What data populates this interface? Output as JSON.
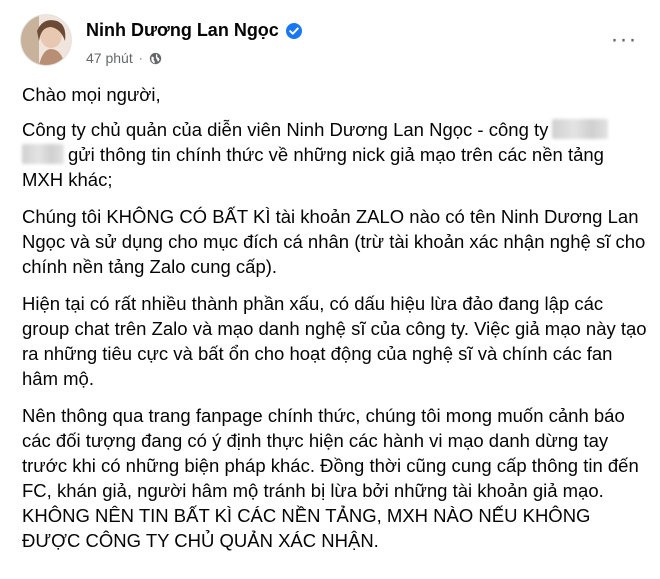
{
  "header": {
    "author_name": "Ninh Dương Lan Ngọc",
    "timestamp": "47 phút",
    "separator": "·",
    "verified_icon": "verified-badge-icon",
    "audience_icon": "globe-icon",
    "more_label": "···"
  },
  "post": {
    "greeting": "Chào mọi người,",
    "p1_start": "Công ty chủ quản của diễn viên Ninh Dương Lan Ngọc - công ty",
    "p1_end": "gửi thông tin chính thức về những nick giả mạo trên các nền tảng MXH khác;",
    "p2": "Chúng tôi KHÔNG CÓ BẤT KÌ tài khoản ZALO nào có tên Ninh Dương Lan Ngọc và sử dụng cho mục đích cá nhân (trừ tài khoản xác nhận nghệ sĩ cho chính nền tảng Zalo cung cấp).",
    "p3": "Hiện tại có rất nhiều thành phần xấu, có dấu hiệu lừa đảo đang lập các group chat trên Zalo và mạo danh nghệ sĩ của công ty. Việc giả mạo này tạo ra những tiêu cực và bất ổn cho hoạt động của nghệ sĩ và chính các fan hâm mộ.",
    "p4": "Nên thông qua trang fanpage chính thức, chúng tôi mong muốn cảnh báo các đối tượng đang có ý định thực hiện các hành vi mạo danh dừng tay trước khi có những biện pháp khác. Đồng thời cũng cung cấp thông tin đến FC, khán giả, người hâm mộ tránh bị lừa bởi những tài khoản giả mạo. KHÔNG NÊN TIN BẤT KÌ CÁC NỀN TẢNG, MXH NÀO NẾU KHÔNG ĐƯỢC CÔNG TY CHỦ QUẢN XÁC NHẬN."
  },
  "colors": {
    "text": "#050505",
    "secondary": "#65676b",
    "verified": "#1877f2"
  }
}
